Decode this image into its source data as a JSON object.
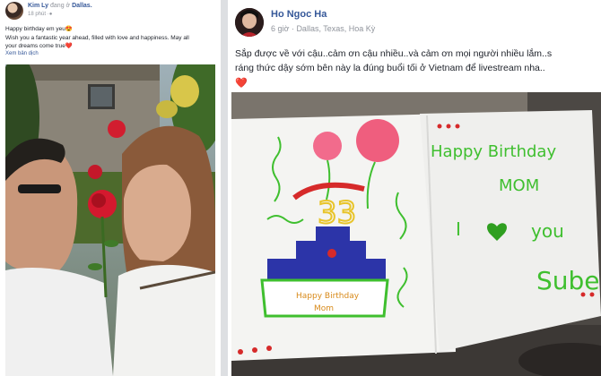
{
  "left_post": {
    "author": "Kim Ly",
    "action": " đang ở ",
    "place": "Dallas.",
    "time": "18 phút",
    "lines": [
      "Happy birthday em yeu😍",
      "Wish you a fantastic year ahead, filled with love and happiness. May all",
      "your dreams come true❤️"
    ],
    "translate_label": "Xem bản dịch"
  },
  "right_post": {
    "author": "Ho Ngoc Ha",
    "time": "6 giờ",
    "location": "Dallas, Texas, Hoa Kỳ",
    "lines": [
      "Sắp được về với cậu..cảm ơn cậu nhiều..và cảm ơn mọi người nhiều lắm..s",
      "ráng thức dậy sớm bên này la đúng buổi tối ở Vietnam để livestream nha.."
    ],
    "heart": "❤️"
  },
  "card": {
    "line1": "Happy Birthday",
    "line2": "MOM",
    "line3_left": "I",
    "line3_right": "you",
    "signature": "Sube",
    "cake_text1": "Happy Birthday",
    "cake_text2": "Mom"
  },
  "colors": {
    "link": "#365899",
    "meta": "#90949c",
    "card_green": "#3fbf2f",
    "card_pink": "#f0607a"
  }
}
